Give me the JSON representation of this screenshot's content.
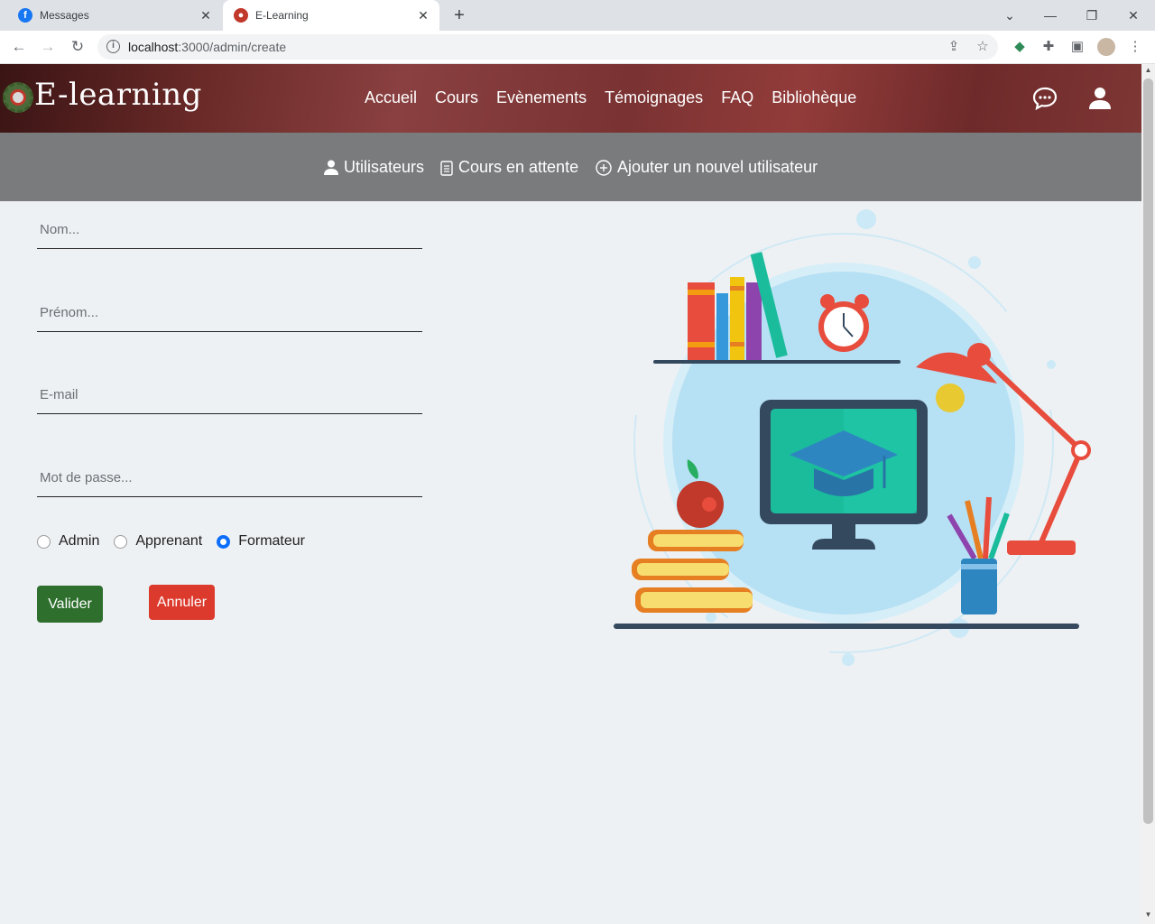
{
  "browser": {
    "tabs": [
      {
        "title": "Messages",
        "active": false
      },
      {
        "title": "E-Learning",
        "active": true
      }
    ],
    "url_host": "localhost",
    "url_path": ":3000/admin/create"
  },
  "site": {
    "logo_text": "E-learning",
    "nav": [
      "Accueil",
      "Cours",
      "Evènements",
      "Témoignages",
      "FAQ",
      "Bibliohèque"
    ],
    "icons": [
      "chat-icon",
      "user-icon"
    ]
  },
  "admin_nav": {
    "users": "Utilisateurs",
    "pending": "Cours en attente",
    "add_user": "Ajouter un nouvel utilisateur"
  },
  "form": {
    "nom_placeholder": "Nom...",
    "prenom_placeholder": "Prénom...",
    "email_placeholder": "E-mail",
    "password_placeholder": "Mot de passe...",
    "roles": [
      {
        "label": "Admin",
        "checked": false
      },
      {
        "label": "Apprenant",
        "checked": false
      },
      {
        "label": "Formateur",
        "checked": true
      }
    ],
    "submit": "Valider",
    "cancel": "Annuler"
  },
  "colors": {
    "header": "#7a3232",
    "subnav": "#7a7b7d",
    "valider": "#2e6f2e",
    "annuler": "#dc3a2c",
    "radio_checked": "#0d6efd"
  }
}
